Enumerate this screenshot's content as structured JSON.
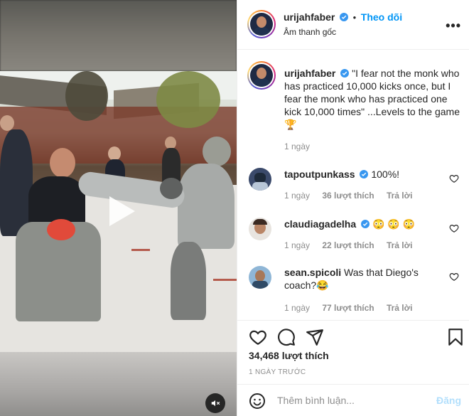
{
  "colors": {
    "link_blue": "#0095f6",
    "post_disabled": "#b2dffc",
    "muted": "#8e8e8e",
    "text": "#262626"
  },
  "media": {
    "play_icon": "play-icon",
    "mute_icon": "speaker-muted-icon"
  },
  "header": {
    "username": "urijahfaber",
    "follow_label": "Theo dõi",
    "subtitle": "Âm thanh gốc",
    "more_icon": "more-options-icon"
  },
  "caption": {
    "username": "urijahfaber",
    "text": "\"I fear not the monk who has practiced 10,000 kicks once, but I fear the monk who has practiced one kick 10,000 times\" ...Levels to the game 🏆",
    "time": "1 ngày"
  },
  "comments": [
    {
      "username": "tapoutpunkass",
      "verified": true,
      "text": "100%!",
      "time": "1 ngày",
      "likes": "36 lượt thích",
      "reply": "Trả lời"
    },
    {
      "username": "claudiagadelha",
      "verified": true,
      "text": "😳 😳 😳",
      "time": "1 ngày",
      "likes": "22 lượt thích",
      "reply": "Trả lời"
    },
    {
      "username": "sean.spicoli",
      "verified": false,
      "text": "Was that Diego's coach?😂",
      "time": "1 ngày",
      "likes": "77 lượt thích",
      "reply": "Trả lời"
    }
  ],
  "actions": {
    "like_icon": "heart-icon",
    "comment_icon": "comment-icon",
    "share_icon": "share-icon",
    "save_icon": "bookmark-icon"
  },
  "likes_count": "34,468 lượt thích",
  "posted_ago": "1 NGÀY TRƯỚC",
  "add_comment": {
    "placeholder": "Thêm bình luận...",
    "post_label": "Đăng",
    "emoji_icon": "emoji-icon"
  }
}
